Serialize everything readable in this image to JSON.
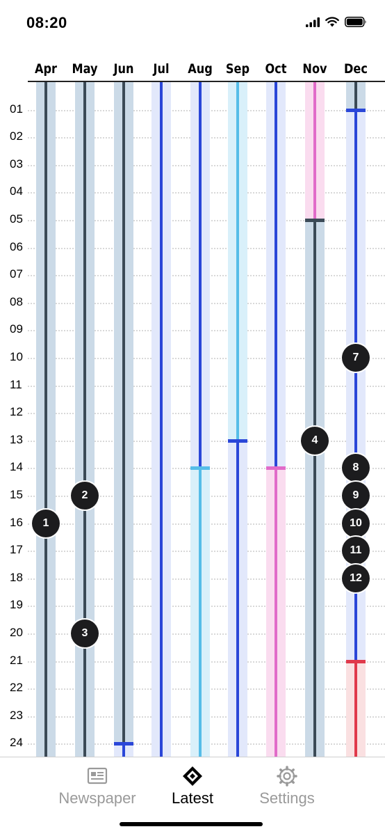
{
  "status_bar": {
    "time": "08:20"
  },
  "months": [
    "Apr",
    "May",
    "Jun",
    "Jul",
    "Aug",
    "Sep",
    "Oct",
    "Nov",
    "Dec"
  ],
  "days": [
    "01",
    "02",
    "03",
    "04",
    "05",
    "06",
    "07",
    "08",
    "09",
    "10",
    "11",
    "12",
    "13",
    "14",
    "15",
    "16",
    "17",
    "18",
    "19",
    "20",
    "21",
    "22",
    "23",
    "24"
  ],
  "colors": {
    "dark": "#3b4a56",
    "dark_band": "#cbdae7",
    "blue": "#2a46d8",
    "blue_band": "#e2e8fb",
    "light_blue": "#56bde8",
    "light_blue_band": "#d9f0fa",
    "pink": "#e16bc9",
    "pink_band": "#fadcef",
    "red": "#e0394b",
    "red_band": "#fae0e1"
  },
  "timeline": {
    "Apr": [
      {
        "from": 0,
        "to": 24.6,
        "color": "dark"
      }
    ],
    "May": [
      {
        "from": 0,
        "to": 24.6,
        "color": "dark"
      }
    ],
    "Jun": [
      {
        "from": 0,
        "to": 24,
        "color": "dark"
      },
      {
        "from": 24,
        "to": 24.6,
        "color": "blue"
      }
    ],
    "Jul": [
      {
        "from": 0,
        "to": 24.6,
        "color": "blue"
      }
    ],
    "Aug": [
      {
        "from": 0,
        "to": 14,
        "color": "blue"
      },
      {
        "from": 14,
        "to": 24.6,
        "color": "light_blue"
      }
    ],
    "Sep": [
      {
        "from": 0,
        "to": 13,
        "color": "light_blue"
      },
      {
        "from": 13,
        "to": 24.6,
        "color": "blue"
      }
    ],
    "Oct": [
      {
        "from": 0,
        "to": 14,
        "color": "blue"
      },
      {
        "from": 14,
        "to": 24.6,
        "color": "pink"
      }
    ],
    "Nov": [
      {
        "from": 0,
        "to": 5,
        "color": "pink"
      },
      {
        "from": 5,
        "to": 24.6,
        "color": "dark"
      }
    ],
    "Dec": [
      {
        "from": 0,
        "to": 1,
        "color": "dark"
      },
      {
        "from": 1,
        "to": 21,
        "color": "blue"
      },
      {
        "from": 21,
        "to": 24.6,
        "color": "red"
      }
    ]
  },
  "markers": [
    {
      "label": "1",
      "month": "Apr",
      "day": 16
    },
    {
      "label": "2",
      "month": "May",
      "day": 15
    },
    {
      "label": "3",
      "month": "May",
      "day": 20
    },
    {
      "label": "4",
      "month": "Nov",
      "day": 13
    },
    {
      "label": "7",
      "month": "Dec",
      "day": 10
    },
    {
      "label": "8",
      "month": "Dec",
      "day": 14
    },
    {
      "label": "9",
      "month": "Dec",
      "day": 15
    },
    {
      "label": "10",
      "month": "Dec",
      "day": 16
    },
    {
      "label": "11",
      "month": "Dec",
      "day": 17
    },
    {
      "label": "12",
      "month": "Dec",
      "day": 18
    }
  ],
  "tabs": {
    "newspaper": {
      "label": "Newspaper",
      "icon": "newspaper-icon"
    },
    "latest": {
      "label": "Latest",
      "icon": "diamond-icon"
    },
    "settings": {
      "label": "Settings",
      "icon": "gear-icon"
    }
  }
}
